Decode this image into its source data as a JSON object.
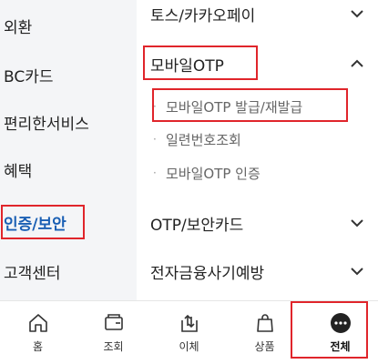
{
  "sidebar": {
    "items": [
      {
        "label": "외환"
      },
      {
        "label": "BC카드"
      },
      {
        "label": "편리한서비스"
      },
      {
        "label": "혜택"
      },
      {
        "label": "인증/보안",
        "active": true
      },
      {
        "label": "고객센터"
      }
    ]
  },
  "main": {
    "sections": [
      {
        "label": "토스/카카오페이",
        "icon": "chevron-down-icon"
      },
      {
        "label": "모바일OTP",
        "icon": "chevron-up-icon",
        "expanded": true
      },
      {
        "label": "OTP/보안카드",
        "icon": "chevron-down-icon"
      },
      {
        "label": "전자금융사기예방",
        "icon": "chevron-down-icon"
      }
    ],
    "subitems": [
      {
        "label": "모바일OTP 발급/재발급",
        "highlighted": true
      },
      {
        "label": "일련번호조회"
      },
      {
        "label": "모바일OTP 인증"
      }
    ]
  },
  "bottom_nav": {
    "items": [
      {
        "label": "홈",
        "icon": "home-icon"
      },
      {
        "label": "조회",
        "icon": "wallet-icon"
      },
      {
        "label": "이체",
        "icon": "transfer-icon"
      },
      {
        "label": "상품",
        "icon": "shopping-bag-icon"
      },
      {
        "label": "전체",
        "icon": "more-icon",
        "active": true
      }
    ]
  },
  "colors": {
    "highlight_box": "#e0252b",
    "active_text": "#1a5fb4",
    "sidebar_bg": "#f4f5f7"
  }
}
